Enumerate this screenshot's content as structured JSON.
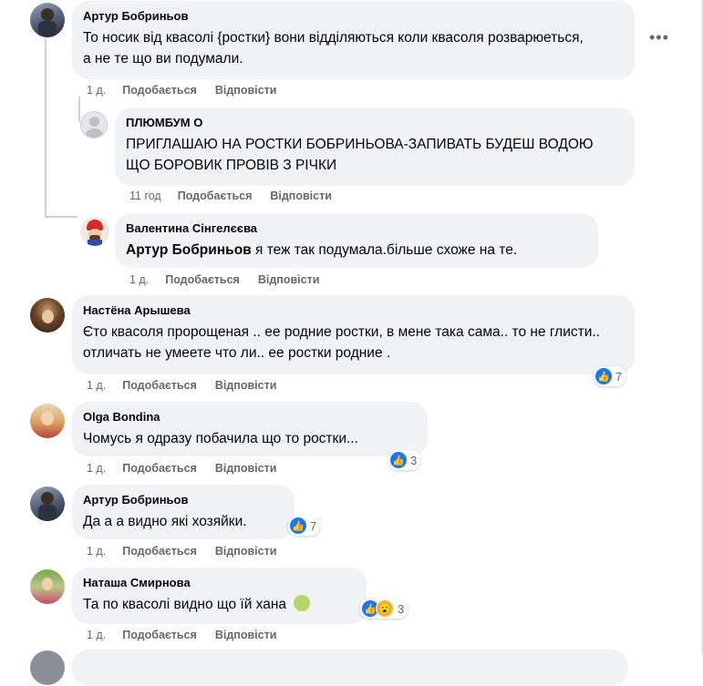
{
  "comments": [
    {
      "author": "Артур Бобриньов",
      "text": "То носик від квасолі {ростки} вони відділяються коли квасоля розварюеться, а не те що ви подумали.",
      "time": "1 д.",
      "like": "Подобається",
      "reply": "Відповісти"
    },
    {
      "author": "ПЛЮМБУМ О",
      "text": "ПРИГЛАШАЮ НА РОСТКИ БОБРИНЬОВА-ЗАПИВАТЬ БУДЕШ ВОДОЮ ЩО БОРОВИК ПРОВІВ З РІЧКИ",
      "time": "11 год",
      "like": "Подобається",
      "reply": "Відповісти"
    },
    {
      "author": "Валентина Сінгелєєва",
      "mention": "Артур Бобриньов",
      "text": "я теж так подумала.більше схоже на те.",
      "time": "1 д.",
      "like": "Подобається",
      "reply": "Відповісти"
    },
    {
      "author": "Настёна Арышева",
      "text": "Єто квасоля пророщеная .. ее родние ростки, в мене така сама.. то не глисти.. отличать не умеете что ли.. ее ростки родние .",
      "time": "1 д.",
      "like": "Подобається",
      "reply": "Відповісти",
      "reaction_count": "7"
    },
    {
      "author": "Olga Bondina",
      "text": "Чомусь я одразу побачила що то ростки...",
      "time": "1 д.",
      "like": "Подобається",
      "reply": "Відповісти",
      "reaction_count": "3"
    },
    {
      "author": "Артур Бобриньов",
      "text": "Да а а видно які хозяйки.",
      "time": "1 д.",
      "like": "Подобається",
      "reply": "Відповісти",
      "reaction_count": "7"
    },
    {
      "author": "Наташа Смирнова",
      "text": "Та по квасолі видно що їй хана",
      "time": "1 д.",
      "like": "Подобається",
      "reply": "Відповісти",
      "reaction_count": "3"
    }
  ],
  "icons": {
    "more": "more-dots-icon",
    "like_reaction": "like-reaction-icon",
    "wow_reaction": "wow-reaction-icon"
  },
  "colors": {
    "like_blue": "#1877f2",
    "bubble": "#f0f2f5",
    "meta_text": "#65676b"
  }
}
